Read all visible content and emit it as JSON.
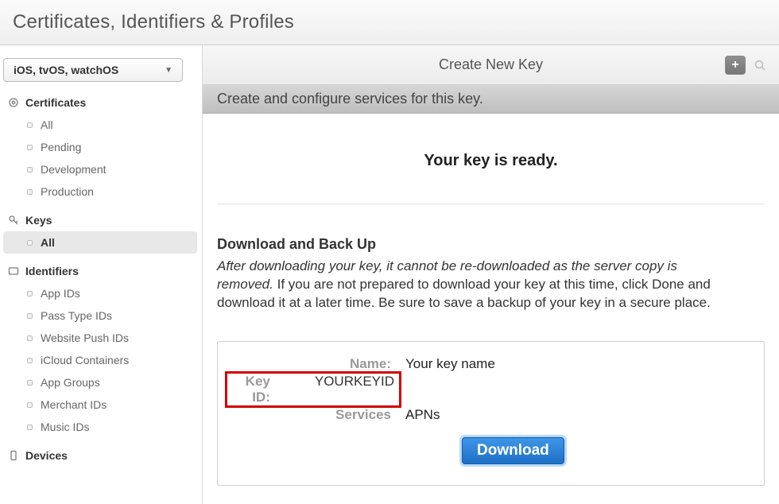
{
  "header": {
    "title": "Certificates, Identifiers & Profiles"
  },
  "platform_selector": {
    "label": "iOS, tvOS, watchOS"
  },
  "sidebar": {
    "sections": [
      {
        "icon": "gear",
        "label": "Certificates",
        "items": [
          {
            "label": "All",
            "selected": false
          },
          {
            "label": "Pending",
            "selected": false
          },
          {
            "label": "Development",
            "selected": false
          },
          {
            "label": "Production",
            "selected": false
          }
        ]
      },
      {
        "icon": "key",
        "label": "Keys",
        "items": [
          {
            "label": "All",
            "selected": true
          }
        ]
      },
      {
        "icon": "id",
        "label": "Identifiers",
        "items": [
          {
            "label": "App IDs",
            "selected": false
          },
          {
            "label": "Pass Type IDs",
            "selected": false
          },
          {
            "label": "Website Push IDs",
            "selected": false
          },
          {
            "label": "iCloud Containers",
            "selected": false
          },
          {
            "label": "App Groups",
            "selected": false
          },
          {
            "label": "Merchant IDs",
            "selected": false
          },
          {
            "label": "Music IDs",
            "selected": false
          }
        ]
      },
      {
        "icon": "device",
        "label": "Devices",
        "items": []
      }
    ]
  },
  "topbar": {
    "title": "Create New Key"
  },
  "subhead": "Create and configure services for this key.",
  "main": {
    "ready_title": "Your key is ready.",
    "download_heading": "Download and Back Up",
    "download_text_italic": "After downloading your key, it cannot be re-downloaded as the server copy is removed.",
    "download_text_rest": " If you are not prepared to download your key at this time, click Done and download it at a later time. Be sure to save a backup of your key in a secure place.",
    "info": {
      "name_label": "Name:",
      "name_value": "Your key name",
      "keyid_label": "Key ID:",
      "keyid_value": "YOURKEYID",
      "services_label": "Services",
      "services_value": "APNs"
    },
    "download_button": "Download"
  }
}
